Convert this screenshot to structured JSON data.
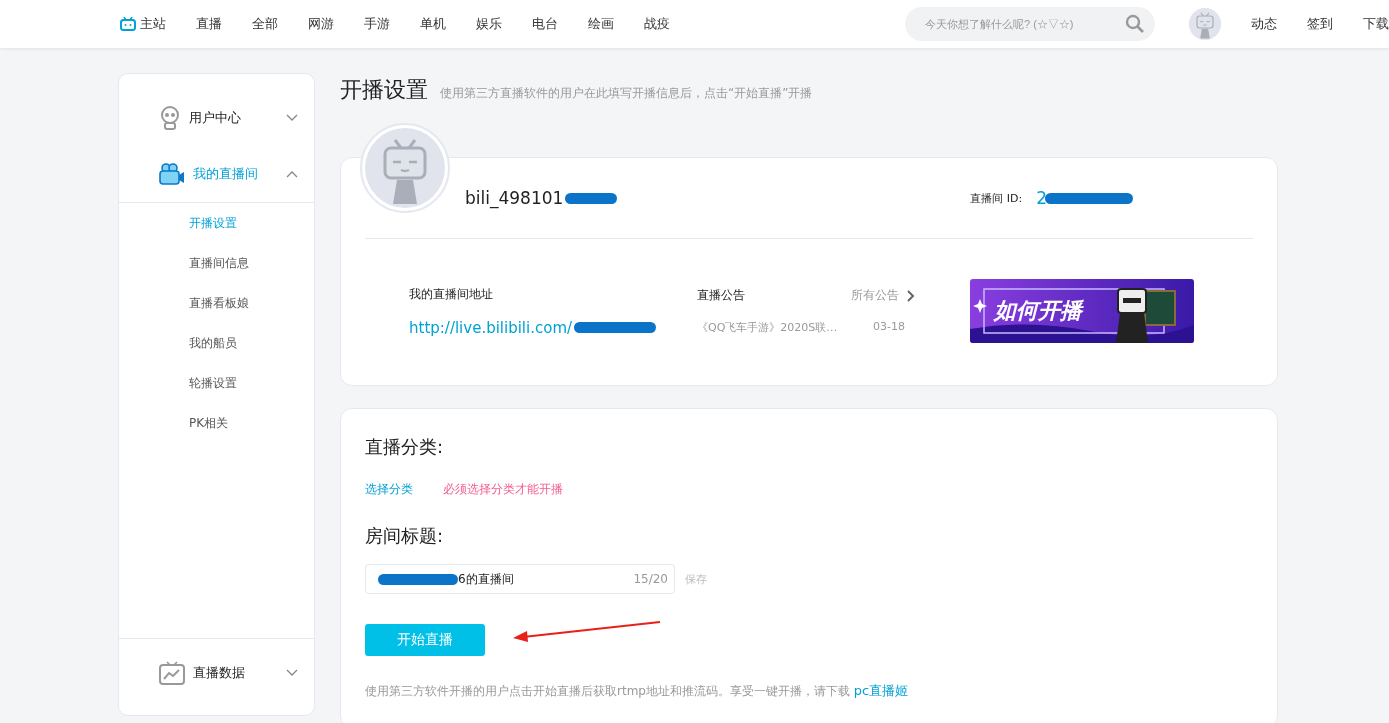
{
  "nav": {
    "home": "主站",
    "links": [
      "直播",
      "全部",
      "网游",
      "手游",
      "单机",
      "娱乐",
      "电台",
      "绘画",
      "战疫"
    ],
    "search": {
      "placeholder": "今天你想了解什么呢? (☆▽☆)"
    },
    "right_links": [
      "动态",
      "签到",
      "下载"
    ]
  },
  "sidebar": {
    "groups": [
      {
        "label": "用户中心",
        "kind": "user",
        "expanded": false,
        "selected": false
      },
      {
        "label": "我的直播间",
        "kind": "camera",
        "expanded": true,
        "selected": true,
        "children": [
          {
            "label": "开播设置",
            "selected": true
          },
          {
            "label": "直播间信息",
            "selected": false
          },
          {
            "label": "直播看板娘",
            "selected": false
          },
          {
            "label": "我的船员",
            "selected": false
          },
          {
            "label": "轮播设置",
            "selected": false
          },
          {
            "label": "PK相关",
            "selected": false
          }
        ]
      }
    ],
    "bottom": {
      "label": "直播数据",
      "kind": "chart",
      "expanded": false
    }
  },
  "page": {
    "title": "开播设置",
    "subtitle": "使用第三方直播软件的用户在此填写开播信息后，点击“开始直播”开播"
  },
  "profile": {
    "username": "bili_498101",
    "room_id_label": "直播间 ID:",
    "room_id": "2",
    "address_label": "我的直播间地址",
    "address": "http://live.bilibili.com/",
    "notice_label": "直播公告",
    "notice_all": "所有公告",
    "notice": {
      "text": "《QQ飞车手游》2020S联…",
      "date": "03-18"
    },
    "banner": {
      "text": "如何开播"
    }
  },
  "settings": {
    "category_label": "直播分类:",
    "category_link": "选择分类",
    "category_warning": "必须选择分类才能开播",
    "title_label": "房间标题:",
    "title_value": "6的直播间",
    "title_count": "15/20",
    "save": "保存",
    "start_button": "开始直播",
    "footer": "使用第三方软件开播的用户点击开始直播后获取rtmp地址和推流码。享受一键开播，请下载 ",
    "footer_link": "pc直播姬"
  }
}
